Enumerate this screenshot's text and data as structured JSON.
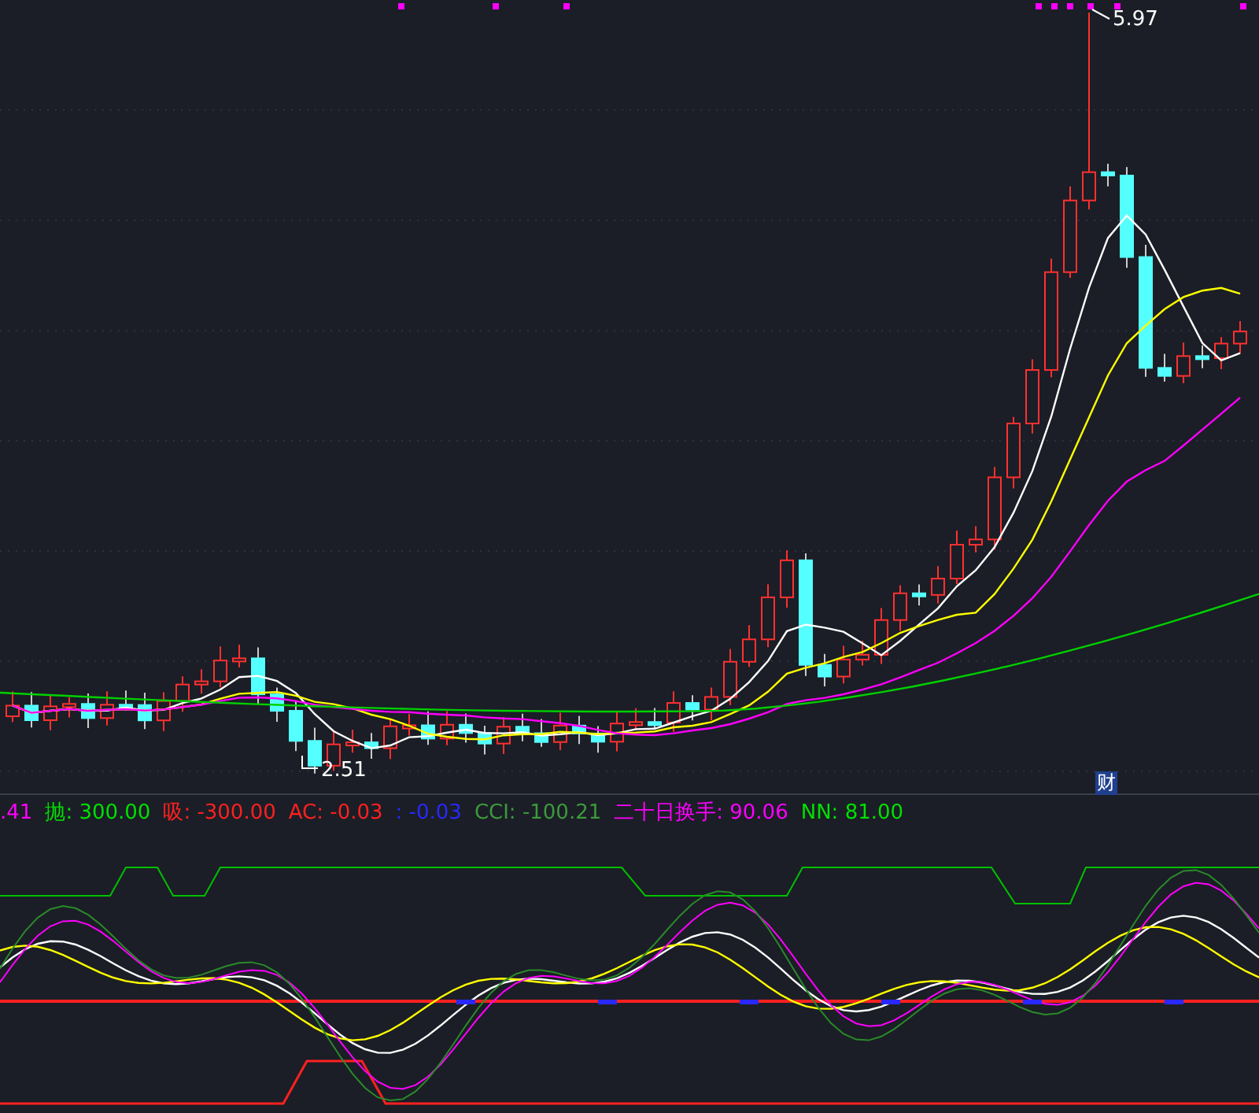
{
  "price_chart": {
    "high_label": "5.97",
    "low_label": "2.51",
    "marker": "财"
  },
  "indicator_legend": [
    {
      "text": ".41",
      "color": "#ff00ff"
    },
    {
      "text": "抛: 300.00",
      "color": "#00e000"
    },
    {
      "text": "吸: -300.00",
      "color": "#ff2020"
    },
    {
      "text": "AC: -0.03",
      "color": "#ff2020"
    },
    {
      "text": ": -0.03",
      "color": "#2828ff"
    },
    {
      "text": "CCI: -100.21",
      "color": "#3c9a3c"
    },
    {
      "text": "二十日换手: 90.06",
      "color": "#ff00ff"
    },
    {
      "text": "NN: 81.00",
      "color": "#00e000"
    }
  ]
}
